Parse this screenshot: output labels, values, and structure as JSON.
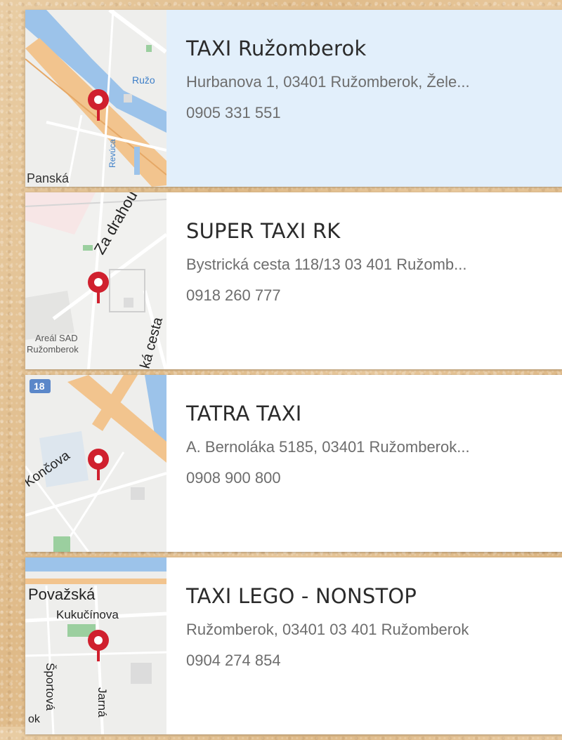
{
  "listings": [
    {
      "name": "TAXI Ružomberok",
      "address": "Hurbanova 1, 03401 Ružomberok, Žele...",
      "phone": "0905 331 551",
      "selected": true,
      "map_labels": {
        "a": "Panská",
        "b": "Revúca",
        "c": "Ružo"
      }
    },
    {
      "name": "SUPER TAXI RK",
      "address": "Bystrická cesta 118/13 03 401 Ružomb...",
      "phone": "0918 260 777",
      "selected": false,
      "map_labels": {
        "a": "Za drahou",
        "b": "Areál SAD",
        "c": "Ružomberok",
        "d": "ká cesta"
      }
    },
    {
      "name": "TATRA TAXI",
      "address": "A. Bernoláka 5185, 03401 Ružomberok...",
      "phone": "0908 900 800",
      "selected": false,
      "map_labels": {
        "a": "Končova",
        "shield": "18"
      }
    },
    {
      "name": "TAXI LEGO - NONSTOP",
      "address": "Ružomberok, 03401 03 401 Ružomberok",
      "phone": "0904 274 854",
      "selected": false,
      "map_labels": {
        "a": "Považská",
        "b": "Kukučínova",
        "c": "Športová",
        "d": "Jarná",
        "e": "ok"
      }
    }
  ],
  "colors": {
    "pin": "#d0202e",
    "selected_bg": "#e2effb",
    "road_major": "#f2c48e",
    "water": "#9cc3ea",
    "map_bg": "#eeeeec"
  }
}
